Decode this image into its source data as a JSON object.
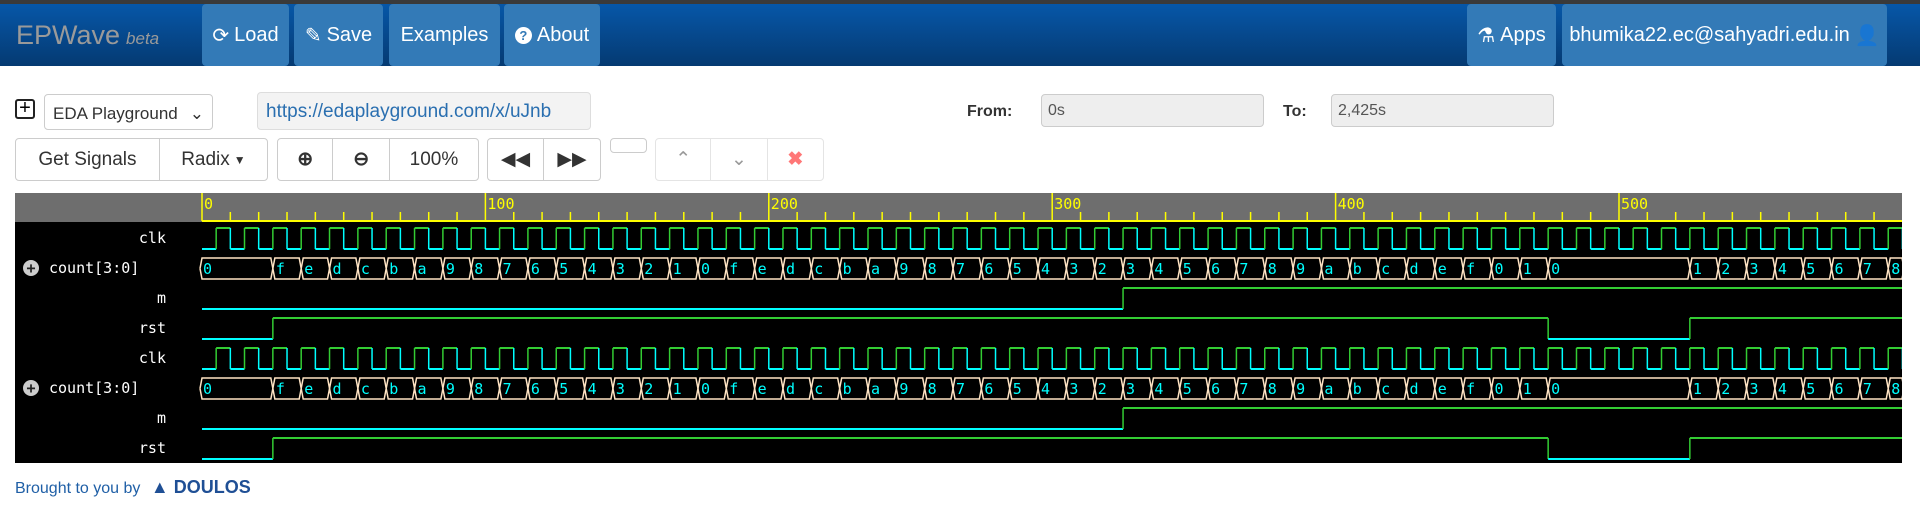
{
  "navbar": {
    "brand": "EPWave",
    "brand_tag": "beta",
    "load": "Load",
    "save": "Save",
    "examples": "Examples",
    "about": "About",
    "apps": "Apps",
    "user": "bhumika22.ec@sahyadri.edu.in"
  },
  "toolbar": {
    "playground_select": "EDA Playground",
    "url": "https://edaplayground.com/x/uJnb",
    "from_label": "From:",
    "from_value": "0s",
    "to_label": "To:",
    "to_value": "2,425s",
    "get_signals": "Get Signals",
    "radix": "Radix",
    "zoom_level": "100%"
  },
  "footer": {
    "text": "Brought to you by",
    "logo": "DOULOS"
  },
  "colors": {
    "nav": "#0657a8",
    "button": "#337ab7",
    "high": "#33cc33",
    "low": "#00ffff",
    "bus": "#ffe4c4",
    "ruler": "#ffff00"
  },
  "waveform": {
    "range": [
      0,
      600
    ],
    "ruler_labels": [
      "0",
      "100",
      "200",
      "300",
      "400",
      "500"
    ],
    "signals": [
      {
        "name": "clk",
        "type": "clock",
        "period": 10,
        "first_rise": 5
      },
      {
        "name": "count[3:0]",
        "type": "bus",
        "changes": [
          [
            0,
            "0"
          ],
          [
            25,
            "f"
          ],
          [
            35,
            "e"
          ],
          [
            45,
            "d"
          ],
          [
            55,
            "c"
          ],
          [
            65,
            "b"
          ],
          [
            75,
            "a"
          ],
          [
            85,
            "9"
          ],
          [
            95,
            "8"
          ],
          [
            105,
            "7"
          ],
          [
            115,
            "6"
          ],
          [
            125,
            "5"
          ],
          [
            135,
            "4"
          ],
          [
            145,
            "3"
          ],
          [
            155,
            "2"
          ],
          [
            165,
            "1"
          ],
          [
            175,
            "0"
          ],
          [
            185,
            "f"
          ],
          [
            195,
            "e"
          ],
          [
            205,
            "d"
          ],
          [
            215,
            "c"
          ],
          [
            225,
            "b"
          ],
          [
            235,
            "a"
          ],
          [
            245,
            "9"
          ],
          [
            255,
            "8"
          ],
          [
            265,
            "7"
          ],
          [
            275,
            "6"
          ],
          [
            285,
            "5"
          ],
          [
            295,
            "4"
          ],
          [
            305,
            "3"
          ],
          [
            315,
            "2"
          ],
          [
            325,
            "3"
          ],
          [
            335,
            "4"
          ],
          [
            345,
            "5"
          ],
          [
            355,
            "6"
          ],
          [
            365,
            "7"
          ],
          [
            375,
            "8"
          ],
          [
            385,
            "9"
          ],
          [
            395,
            "a"
          ],
          [
            405,
            "b"
          ],
          [
            415,
            "c"
          ],
          [
            425,
            "d"
          ],
          [
            435,
            "e"
          ],
          [
            445,
            "f"
          ],
          [
            455,
            "0"
          ],
          [
            465,
            "1"
          ],
          [
            475,
            "0"
          ],
          [
            525,
            "1"
          ],
          [
            535,
            "2"
          ],
          [
            545,
            "3"
          ],
          [
            555,
            "4"
          ],
          [
            565,
            "5"
          ],
          [
            575,
            "6"
          ],
          [
            585,
            "7"
          ],
          [
            595,
            "8"
          ]
        ]
      },
      {
        "name": "m",
        "type": "bit",
        "changes": [
          [
            0,
            0
          ],
          [
            325,
            1
          ]
        ]
      },
      {
        "name": "rst",
        "type": "bit",
        "changes": [
          [
            0,
            0
          ],
          [
            25,
            1
          ],
          [
            475,
            0
          ],
          [
            525,
            1
          ]
        ]
      },
      {
        "name": "clk",
        "type": "clock",
        "period": 10,
        "first_rise": 5
      },
      {
        "name": "count[3:0]",
        "type": "bus",
        "ref": 1
      },
      {
        "name": "m",
        "type": "bit",
        "changes": [
          [
            0,
            0
          ],
          [
            325,
            1
          ]
        ]
      },
      {
        "name": "rst",
        "type": "bit",
        "changes": [
          [
            0,
            0
          ],
          [
            25,
            1
          ],
          [
            475,
            0
          ],
          [
            525,
            1
          ]
        ]
      }
    ]
  }
}
